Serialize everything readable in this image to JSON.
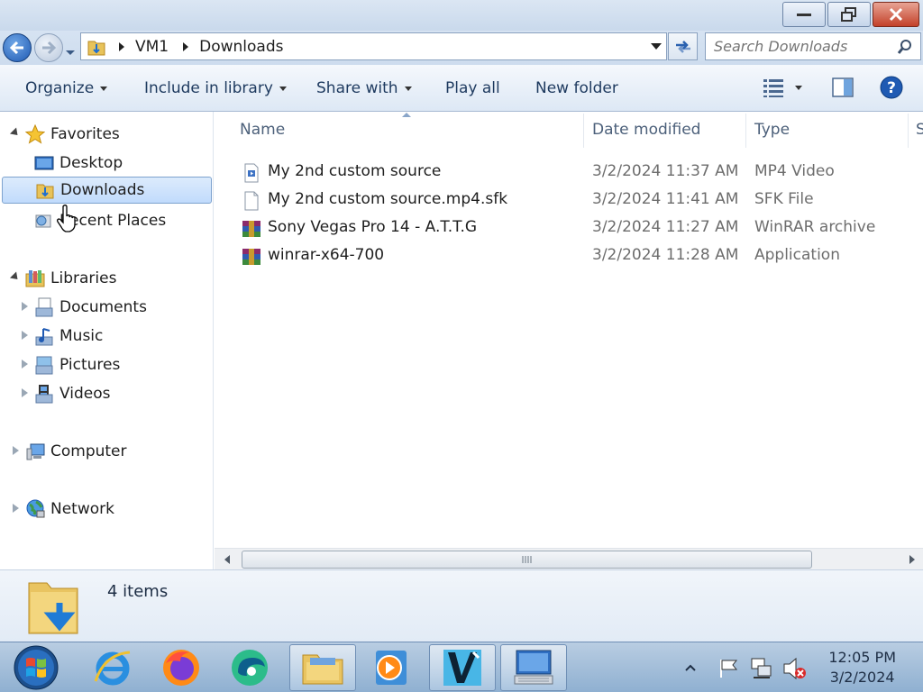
{
  "window": {
    "minimize": "minimize",
    "restore": "restore",
    "close": "close"
  },
  "address": {
    "crumbs": [
      "VM1",
      "Downloads"
    ],
    "search_placeholder": "Search Downloads"
  },
  "toolbar": {
    "organize": "Organize",
    "include_in_library": "Include in library",
    "share_with": "Share with",
    "play_all": "Play all",
    "new_folder": "New folder"
  },
  "nav": {
    "favorites": "Favorites",
    "desktop": "Desktop",
    "downloads": "Downloads",
    "recent_places": "Recent Places",
    "libraries": "Libraries",
    "documents": "Documents",
    "music": "Music",
    "pictures": "Pictures",
    "videos": "Videos",
    "computer": "Computer",
    "network": "Network"
  },
  "columns": {
    "name": "Name",
    "date_modified": "Date modified",
    "type": "Type",
    "size_partial": "S"
  },
  "files": [
    {
      "name": "My 2nd custom source",
      "date": "3/2/2024 11:37 AM",
      "type": "MP4 Video",
      "icon": "video-file-icon"
    },
    {
      "name": "My 2nd custom source.mp4.sfk",
      "date": "3/2/2024 11:41 AM",
      "type": "SFK File",
      "icon": "blank-file-icon"
    },
    {
      "name": "Sony Vegas Pro 14 - A.T.T.G",
      "date": "3/2/2024 11:27 AM",
      "type": "WinRAR archive",
      "icon": "winrar-icon"
    },
    {
      "name": "winrar-x64-700",
      "date": "3/2/2024 11:28 AM",
      "type": "Application",
      "icon": "winrar-icon"
    }
  ],
  "details": {
    "count": "4 items"
  },
  "taskbar": {
    "time": "12:05 PM",
    "date": "3/2/2024"
  },
  "colors": {
    "accent": "#1f5ab3",
    "selection": "#c1dbfc",
    "taskbar": "#8fb0d1"
  }
}
